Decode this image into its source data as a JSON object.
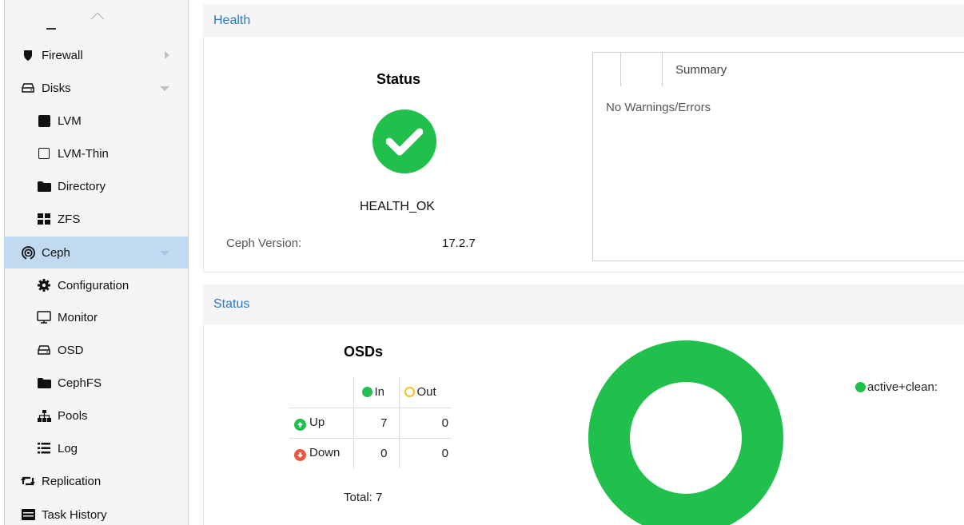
{
  "sidebar": {
    "items": [
      {
        "label": "Firewall",
        "icon": "shield-icon"
      },
      {
        "label": "Disks",
        "icon": "hdd-icon"
      },
      {
        "label": "LVM",
        "icon": "square-filled-icon"
      },
      {
        "label": "LVM-Thin",
        "icon": "square-outline-icon"
      },
      {
        "label": "Directory",
        "icon": "folder-icon"
      },
      {
        "label": "ZFS",
        "icon": "grid-icon"
      },
      {
        "label": "Ceph",
        "icon": "ceph-icon"
      },
      {
        "label": "Configuration",
        "icon": "gear-icon"
      },
      {
        "label": "Monitor",
        "icon": "monitor-icon"
      },
      {
        "label": "OSD",
        "icon": "hdd-icon"
      },
      {
        "label": "CephFS",
        "icon": "folder-icon"
      },
      {
        "label": "Pools",
        "icon": "sitemap-icon"
      },
      {
        "label": "Log",
        "icon": "list-icon"
      },
      {
        "label": "Replication",
        "icon": "retweet-icon"
      },
      {
        "label": "Task History",
        "icon": "list-alt-icon"
      }
    ]
  },
  "health": {
    "header": "Health",
    "status_title": "Status",
    "status_value": "HEALTH_OK",
    "version_label": "Ceph Version:",
    "version_value": "17.2.7",
    "summary_header": "Summary",
    "summary_message": "No Warnings/Errors"
  },
  "status": {
    "header": "Status",
    "osds_title": "OSDs",
    "col_in": "In",
    "col_out": "Out",
    "rows": [
      {
        "label": "Up",
        "in": "7",
        "out": "0"
      },
      {
        "label": "Down",
        "in": "0",
        "out": "0"
      }
    ],
    "total": "Total: 7",
    "pg_legend": "active+clean:"
  },
  "colors": {
    "accent": "#2a79c4",
    "ok_green": "#21bf4b",
    "out_yellow": "#f2c21b",
    "down_red": "#e9573f",
    "selected_bg": "#c2daf1"
  }
}
